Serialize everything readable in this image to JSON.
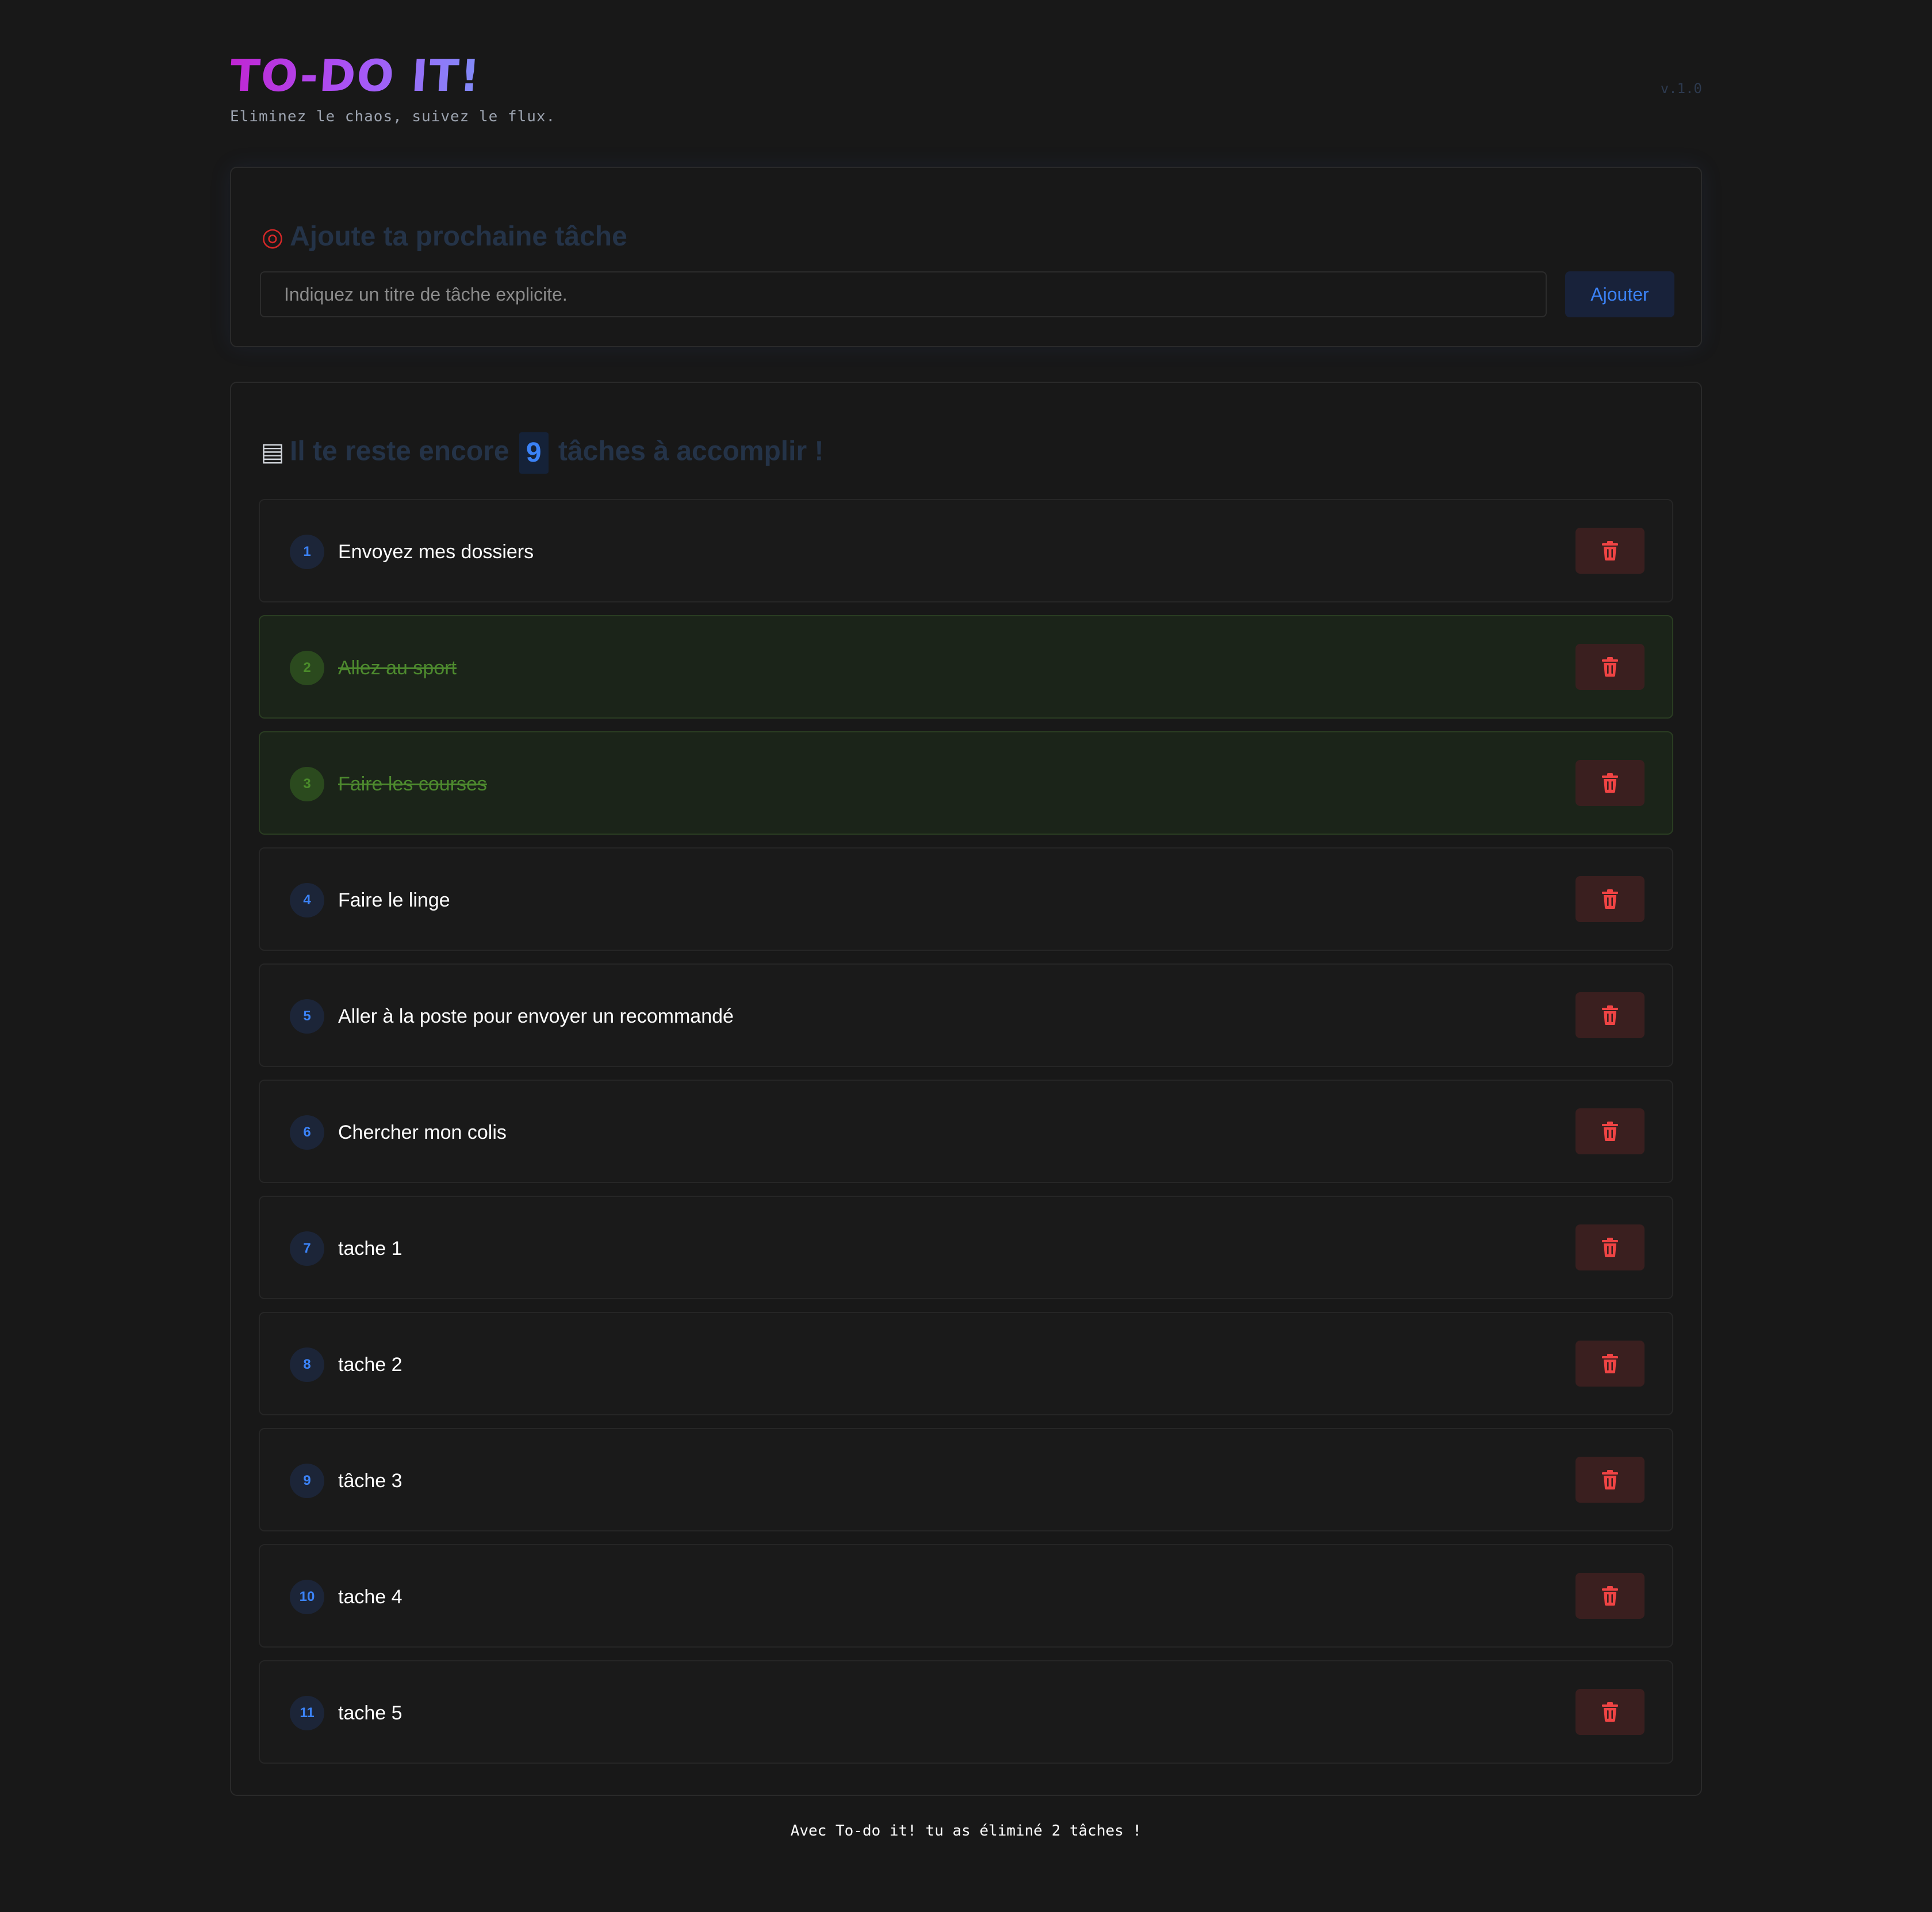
{
  "header": {
    "logo": "TO-DO IT!",
    "tagline": "Eliminez le chaos, suivez le flux.",
    "version": "v.1.0"
  },
  "add_section": {
    "emoji_icon": "dart-target-icon",
    "title": "Ajoute ta prochaine tâche",
    "input_placeholder": "Indiquez un titre de tâche explicite.",
    "input_value": "",
    "button_label": "Ajouter"
  },
  "list_section": {
    "emoji_icon": "document-icon",
    "title_before": "Il te reste encore",
    "remaining_count": "9",
    "title_after": "tâches à accomplir !",
    "tasks": [
      {
        "number": "1",
        "label": "Envoyez mes dossiers",
        "done": false
      },
      {
        "number": "2",
        "label": "Allez au sport",
        "done": true
      },
      {
        "number": "3",
        "label": "Faire les courses",
        "done": true
      },
      {
        "number": "4",
        "label": "Faire le linge",
        "done": false
      },
      {
        "number": "5",
        "label": "Aller à la poste pour envoyer un recommandé",
        "done": false
      },
      {
        "number": "6",
        "label": "Chercher mon colis",
        "done": false
      },
      {
        "number": "7",
        "label": "tache 1",
        "done": false
      },
      {
        "number": "8",
        "label": "tache 2",
        "done": false
      },
      {
        "number": "9",
        "label": "tâche 3",
        "done": false
      },
      {
        "number": "10",
        "label": "tache 4",
        "done": false
      },
      {
        "number": "11",
        "label": "tache 5",
        "done": false
      }
    ]
  },
  "footer": {
    "text": "Avec To-do it! tu as éliminé 2 tâches !"
  },
  "colors": {
    "background": "#181818",
    "accent_blue": "#3b82f6",
    "done_green": "#4d8a2e",
    "delete_red": "#ef4444",
    "logo_gradient": [
      "#c026d3",
      "#a855f7",
      "#818cf8"
    ]
  }
}
